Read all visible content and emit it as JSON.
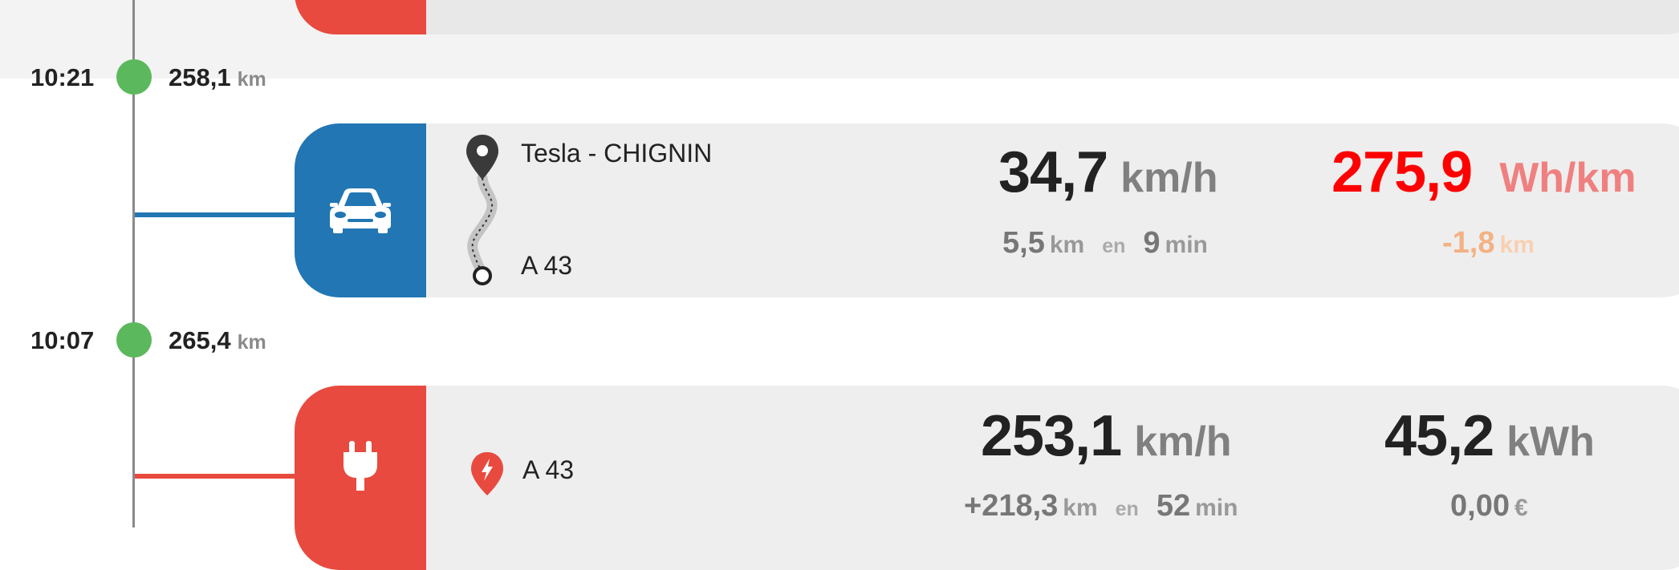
{
  "colors": {
    "drive_accent": "#2176b3",
    "charge_accent": "#e84a3f",
    "waypoint_dot": "#5cb85c",
    "consumption_red": "#ff0000",
    "consumption_unit": "#f08080",
    "range_delta": "#f4b183"
  },
  "timeline": [
    {
      "time": "10:21",
      "odometer": "258,1",
      "unit": "km"
    },
    {
      "time": "10:07",
      "odometer": "265,4",
      "unit": "km"
    }
  ],
  "drive": {
    "icon": "car-icon",
    "start_location": "Tesla - CHIGNIN",
    "end_location": "A 43",
    "speed": "34,7",
    "speed_unit": "km/h",
    "consumption": "275,9",
    "consumption_unit": "Wh/km",
    "distance": "5,5",
    "distance_unit": "km",
    "en": "en",
    "duration": "9",
    "duration_unit": "min",
    "range_delta": "-1,8",
    "range_delta_unit": "km"
  },
  "charge": {
    "icon": "plug-icon",
    "location": "A 43",
    "rate": "253,1",
    "rate_unit": "km/h",
    "energy": "45,2",
    "energy_unit": "kWh",
    "range_added": "+218,3",
    "range_added_unit": "km",
    "en": "en",
    "duration": "52",
    "duration_unit": "min",
    "cost": "0,00",
    "cost_unit": "€"
  }
}
